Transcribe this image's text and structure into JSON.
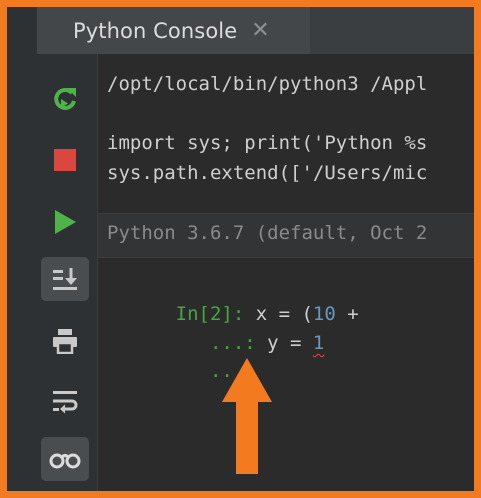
{
  "tab": {
    "title": "Python Console",
    "close_icon": "close-icon"
  },
  "toolbar": {
    "buttons": [
      {
        "name": "rerun-icon",
        "color": "#4fb34a"
      },
      {
        "name": "stop-icon",
        "color": "#d9473f"
      },
      {
        "name": "run-icon",
        "color": "#4fb34a"
      },
      {
        "name": "scroll-to-end-icon",
        "active": true
      },
      {
        "name": "print-icon"
      },
      {
        "name": "soft-wrap-icon"
      },
      {
        "name": "show-variables-icon",
        "active": true
      }
    ]
  },
  "console": {
    "line1": "/opt/local/bin/python3 /Appl",
    "line2": "import sys; print('Python %s",
    "line3": "sys.path.extend(['/Users/mic",
    "banner": "Python 3.6.7 (default, Oct 2",
    "input": {
      "prompt1": "In[2]:",
      "code1_a": " x = (",
      "code1_num": "10",
      "code1_b": " +",
      "prompt2": "   ...:",
      "code2_a": " y = ",
      "code2_num": "1",
      "prompt3": "   ...:"
    }
  },
  "colors": {
    "frame": "#f47a20",
    "prompt": "#44a83c",
    "number": "#6897bb",
    "arrow": "#f47a20"
  }
}
